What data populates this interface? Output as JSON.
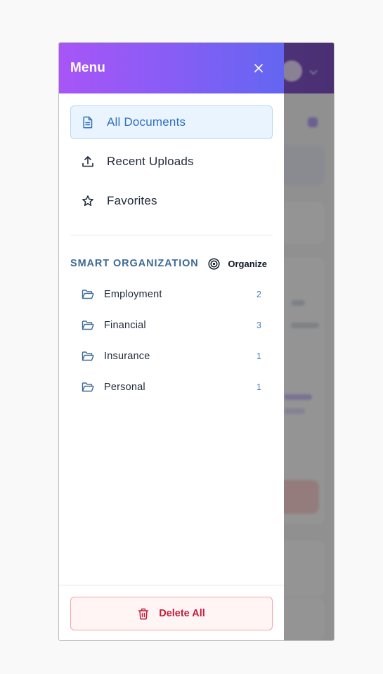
{
  "drawer": {
    "title": "Menu",
    "nav_items": [
      {
        "label": "All Documents",
        "icon": "document-icon",
        "active": true
      },
      {
        "label": "Recent Uploads",
        "icon": "upload-icon",
        "active": false
      },
      {
        "label": "Favorites",
        "icon": "star-icon",
        "active": false
      }
    ],
    "section": {
      "title": "SMART ORGANIZATION",
      "organize_label": "Organize"
    },
    "folders": [
      {
        "name": "Employment",
        "count": "2"
      },
      {
        "name": "Financial",
        "count": "3"
      },
      {
        "name": "Insurance",
        "count": "1"
      },
      {
        "name": "Personal",
        "count": "1"
      }
    ],
    "footer": {
      "delete_label": "Delete All"
    }
  },
  "colors": {
    "header_gradient_start": "#a855f7",
    "header_gradient_end": "#6366f1",
    "active_bg": "#eaf4fe",
    "active_text": "#2f6fc1",
    "section_title": "#3d6a96",
    "danger": "#c51d3a"
  }
}
